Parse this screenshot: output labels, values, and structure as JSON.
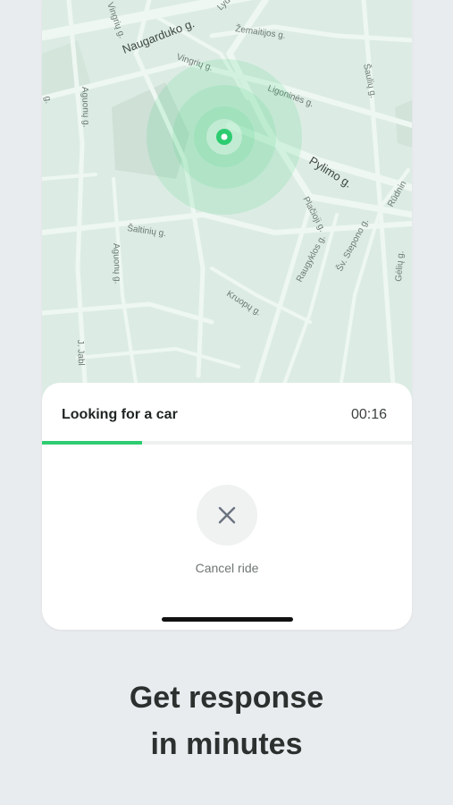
{
  "map": {
    "streets": {
      "naugarduko": "Naugarduko g.",
      "vingriu_top": "Vingrių g.",
      "vingriu_mid": "Vingrių g.",
      "lydos": "Lydo",
      "zemaitijos": "Žemaitijos g.",
      "sauliu": "Šaulių g.",
      "ligonines": "Ligoninės g.",
      "pylimo": "Pylimo g.",
      "rudninku": "Rūdnin",
      "pranciskonu": "Pranciškonų g.",
      "saltiniu": "Šaltinių g.",
      "aguonu_upper": "Aguonų g.",
      "aguonu_lower": "Aguonų g.",
      "placioji": "Plačioji g.",
      "raugyklos": "Raugyklos g.",
      "stepono": "Šv. Stepono g.",
      "gelu": "Gėlių g.",
      "kruopu": "Kruopų g.",
      "jablonskio": "J. Jabl",
      "edge_left": "g."
    }
  },
  "ride": {
    "status": "Looking for a car",
    "timer": "00:16",
    "progress": 0.27,
    "cancel_label": "Cancel ride"
  },
  "promo": {
    "line1": "Get response",
    "line2": "in minutes"
  },
  "colors": {
    "accent": "#2ecc71",
    "map_bg": "#dcece4",
    "road": "#eef7f2"
  }
}
